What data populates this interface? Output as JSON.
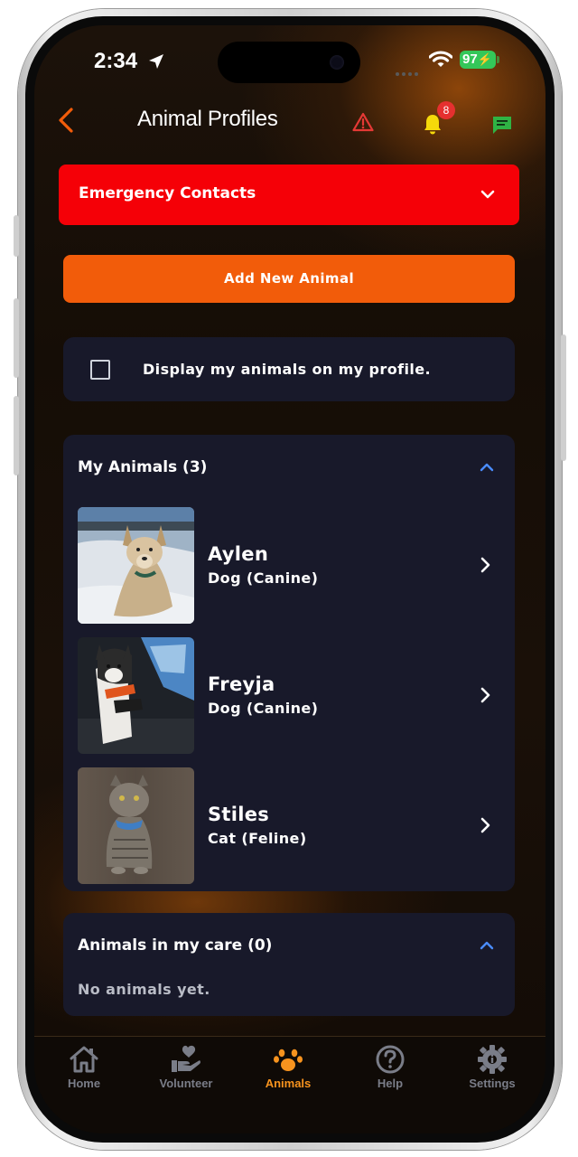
{
  "status_bar": {
    "time": "2:34",
    "battery": "97"
  },
  "header": {
    "title": "Animal Profiles",
    "notification_count": "8"
  },
  "emergency": {
    "label": "Emergency Contacts"
  },
  "add_animal": {
    "label": "Add New Animal"
  },
  "display_option": {
    "label": "Display my animals on my profile.",
    "checked": false
  },
  "my_animals": {
    "title": "My Animals (3)",
    "items": [
      {
        "name": "Aylen",
        "type": "Dog (Canine)"
      },
      {
        "name": "Freyja",
        "type": "Dog (Canine)"
      },
      {
        "name": "Stiles",
        "type": "Cat (Feline)"
      }
    ]
  },
  "care": {
    "title": "Animals in my care (0)",
    "empty_text": "No animals yet."
  },
  "tabs": [
    {
      "label": "Home",
      "icon": "home-icon"
    },
    {
      "label": "Volunteer",
      "icon": "volunteer-hand-heart-icon"
    },
    {
      "label": "Animals",
      "icon": "paw-icon",
      "active": true
    },
    {
      "label": "Help",
      "icon": "help-circle-icon"
    },
    {
      "label": "Settings",
      "icon": "settings-gear-icon"
    }
  ],
  "colors": {
    "accent": "#f25c0a",
    "emergency": "#f50007",
    "card": "#18192a",
    "active_tab": "#f7931e",
    "warning": "#e53935",
    "bell": "#f5d90a",
    "chat": "#2fb344"
  }
}
